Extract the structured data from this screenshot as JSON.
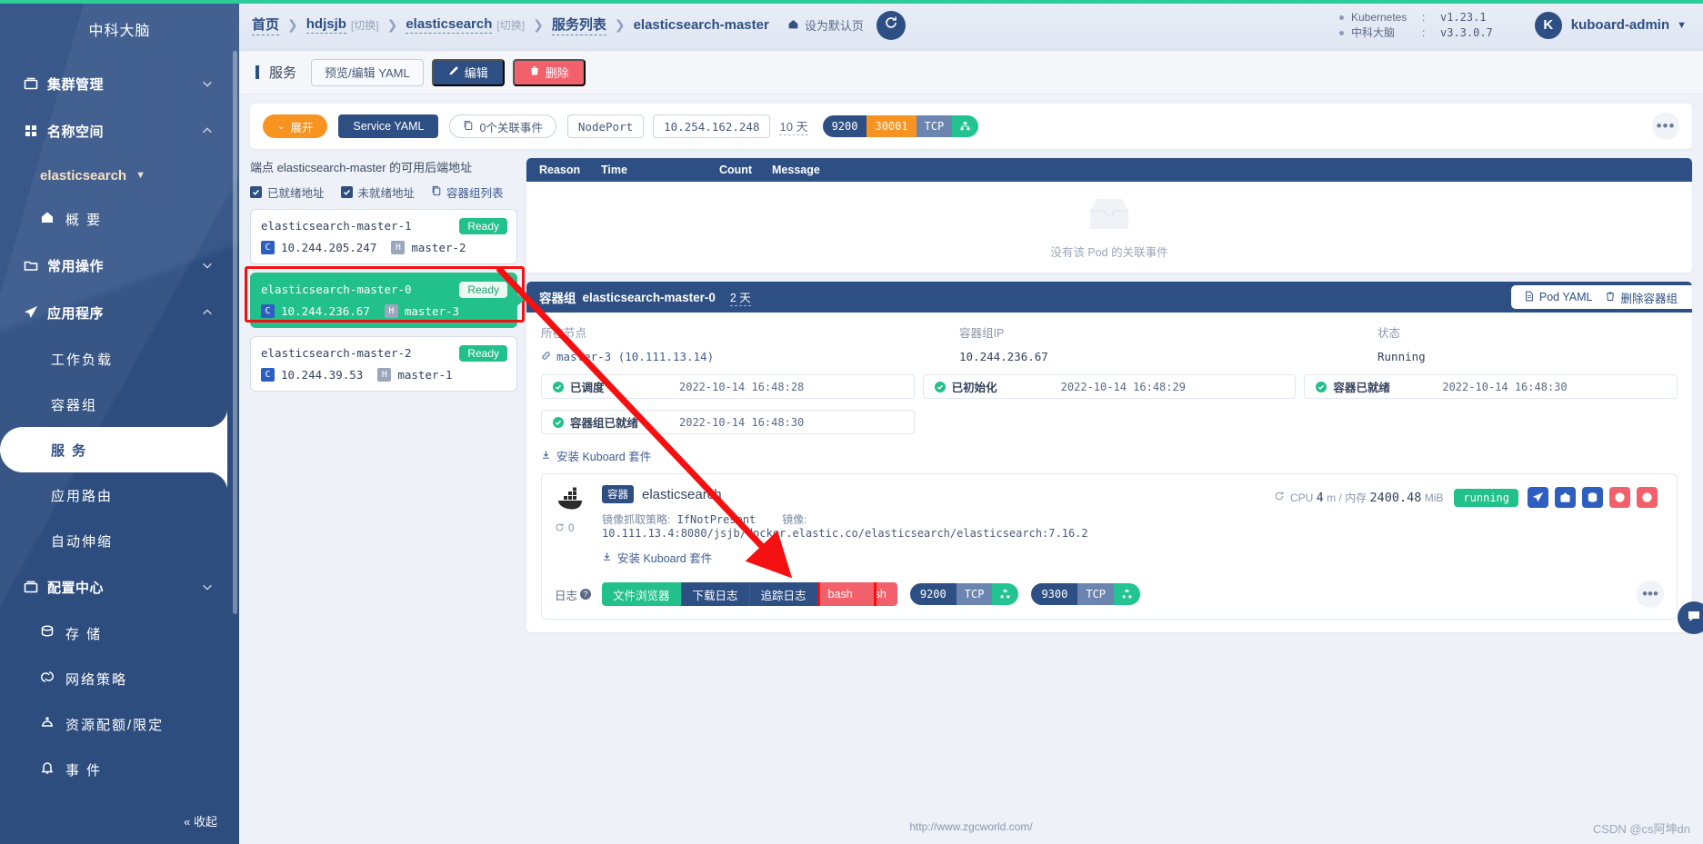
{
  "sidebar": {
    "brand": "中科大脑",
    "groups": [
      {
        "label": "集群管理",
        "icon": "box-icon",
        "chevron": "down"
      },
      {
        "label": "名称空间",
        "icon": "grid-icon",
        "chevron": "up"
      }
    ],
    "namespace": "elasticsearch",
    "items": [
      {
        "label": "概 要",
        "icon": "home-icon"
      },
      {
        "label": "常用操作",
        "icon": "folder-icon",
        "chevron": "down"
      },
      {
        "label": "应用程序",
        "icon": "paper-plane-icon",
        "chevron": "up"
      }
    ],
    "sub_items": [
      {
        "label": "工作负载",
        "active": false
      },
      {
        "label": "容器组",
        "active": false
      },
      {
        "label": "服 务",
        "active": true
      },
      {
        "label": "应用路由",
        "active": false
      },
      {
        "label": "自动伸缩",
        "active": false
      }
    ],
    "lower_items": [
      {
        "label": "配置中心",
        "icon": "box-icon",
        "chevron": "down",
        "bold": true
      },
      {
        "label": "存 储",
        "icon": "database-icon"
      },
      {
        "label": "网络策略",
        "icon": "network-icon"
      },
      {
        "label": "资源配额/限定",
        "icon": "quota-icon"
      },
      {
        "label": "事 件",
        "icon": "bell-icon"
      }
    ],
    "collapse": "收起"
  },
  "header": {
    "breadcrumb": [
      {
        "text": "首页",
        "type": "link"
      },
      {
        "text": "hdjsjb",
        "type": "link",
        "switch": "[切换]"
      },
      {
        "text": "elasticsearch",
        "type": "link",
        "switch": "[切换]"
      },
      {
        "text": "服务列表",
        "type": "link"
      },
      {
        "text": "elasticsearch-master",
        "type": "plain"
      }
    ],
    "set_default_page": "设为默认页",
    "refresh_icon": "refresh-icon",
    "versions": [
      {
        "key": "Kubernetes",
        "colon": ":",
        "value": "v1.23.1"
      },
      {
        "key": "中科大脑",
        "colon": ":",
        "value": "v3.3.0.7"
      }
    ],
    "user": {
      "initial": "K",
      "name": "kuboard-admin"
    }
  },
  "toolbar": {
    "title": "服务",
    "yaml_label": "预览/编辑 YAML",
    "edit_label": "编辑",
    "delete_label": "删除"
  },
  "service_bar": {
    "expand_label": "展开",
    "service_yaml_label": "Service YAML",
    "events_label": "0个关联事件",
    "type": "NodePort",
    "cluster_ip": "10.254.162.248",
    "age": "10 天",
    "port": {
      "port": "9200",
      "node_port": "30001",
      "protocol": "TCP",
      "icon": "network-node-icon"
    },
    "more": "•••"
  },
  "endpoints": {
    "title": "端点 elasticsearch-master 的可用后端地址",
    "checks": [
      {
        "label": "已就绪地址",
        "checked": true
      },
      {
        "label": "未就绪地址",
        "checked": true
      }
    ],
    "pod_list_link": "容器组列表",
    "items": [
      {
        "name": "elasticsearch-master-1",
        "status": "Ready",
        "ip": "10.244.205.247",
        "node": "master-2",
        "selected": false
      },
      {
        "name": "elasticsearch-master-0",
        "status": "Ready",
        "ip": "10.244.236.67",
        "node": "master-3",
        "selected": true
      },
      {
        "name": "elasticsearch-master-2",
        "status": "Ready",
        "ip": "10.244.39.53",
        "node": "master-1",
        "selected": false
      }
    ]
  },
  "events": {
    "columns": [
      "Reason",
      "Time",
      "Count",
      "Message"
    ],
    "empty_text": "没有该 Pod 的关联事件",
    "rows": []
  },
  "pod": {
    "label": "容器组",
    "name": "elasticsearch-master-0",
    "age": "2 天",
    "actions": [
      {
        "label": "Pod YAML",
        "icon": "document-icon"
      },
      {
        "label": "删除容器组",
        "icon": "trash-icon"
      }
    ],
    "fields": [
      {
        "label": "所在节点",
        "value": "master-3 (10.111.13.14)",
        "type": "link"
      },
      {
        "label": "容器组IP",
        "value": "10.244.236.67",
        "type": "mono"
      },
      {
        "label": "状态",
        "value": "Running",
        "type": "mono"
      }
    ],
    "conditions": [
      {
        "name": "已调度",
        "time": "2022-10-14 16:48:28"
      },
      {
        "name": "已初始化",
        "time": "2022-10-14 16:48:29"
      },
      {
        "name": "容器已就绪",
        "time": "2022-10-14 16:48:30"
      },
      {
        "name": "容器组已就绪",
        "time": "2022-10-14 16:48:30"
      }
    ],
    "install_link": "安装 Kuboard 套件",
    "container": {
      "badge": "容器",
      "name": "elasticsearch",
      "restarts": "0",
      "pull_policy_label": "镜像抓取策略:",
      "pull_policy_value": "IfNotPresent",
      "image_label": "镜像:",
      "image_value": "10.111.13.4:8080/jsjb/docker.elastic.co/elasticsearch/elasticsearch:7.16.2",
      "metrics_label": "CPU",
      "cpu": "4",
      "cpu_unit": "m",
      "mem_label": "/ 内存",
      "mem": "2400.48",
      "mem_unit": "MiB",
      "status": "running",
      "action_icons": [
        "send-icon",
        "box-icon",
        "database-icon",
        "alert-icon",
        "alert-icon"
      ],
      "install_link": "安装 Kuboard 套件",
      "log_label": "日志",
      "log_buttons": [
        {
          "label": "文件浏览器",
          "style": "green"
        },
        {
          "label": "下载日志",
          "style": "navy"
        },
        {
          "label": "追踪日志",
          "style": "navy"
        },
        {
          "label": "bash",
          "style": "red",
          "highlighted": true
        },
        {
          "label": "sh",
          "style": "red"
        }
      ],
      "ports": [
        {
          "port": "9200",
          "protocol": "TCP",
          "icon": "network-node-icon"
        },
        {
          "port": "9300",
          "protocol": "TCP",
          "icon": "network-node-icon"
        }
      ],
      "more": "•••"
    }
  },
  "footer": {
    "url": "http://www.zgcworld.com/",
    "watermark": "CSDN @cs阿坤dn"
  },
  "colors": {
    "navy": "#2e4f83",
    "green": "#22c08b",
    "orange": "#f79421",
    "red": "#f2606b",
    "highlight_red": "#f41010"
  }
}
